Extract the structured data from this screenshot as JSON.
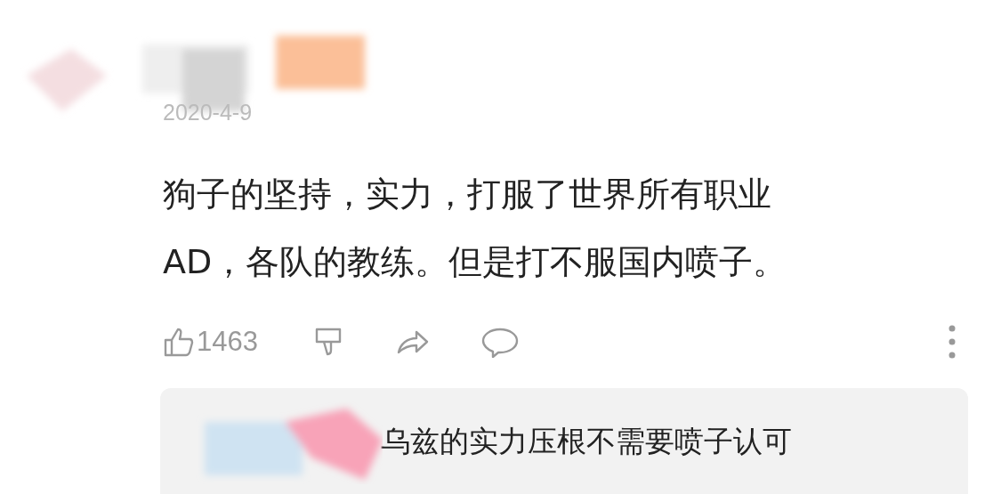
{
  "comment": {
    "date": "2020-4-9",
    "text_lines": [
      "狗子的坚持，实力，打服了世界所有职业",
      "AD，各队的教练。但是打不服国内喷子。"
    ],
    "like_count": "1463"
  },
  "reply": {
    "text": "乌兹的实力压根不需要喷子认可"
  }
}
